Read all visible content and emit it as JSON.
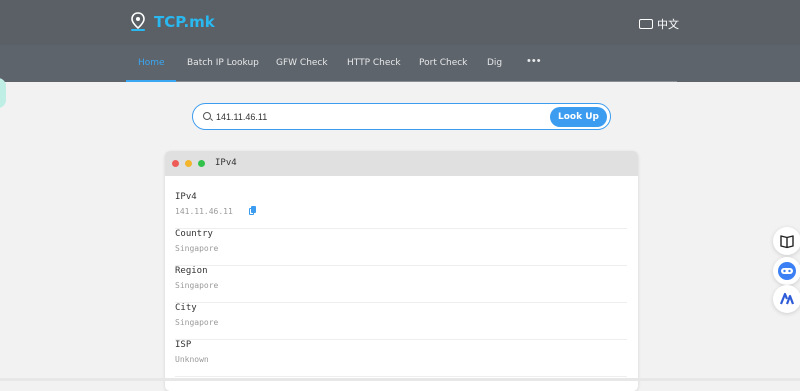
{
  "header": {
    "logo_text": "TCP.mk",
    "language_label": "中文"
  },
  "nav": {
    "items": [
      {
        "label": "Home",
        "active": true
      },
      {
        "label": "Batch IP Lookup",
        "active": false
      },
      {
        "label": "GFW Check",
        "active": false
      },
      {
        "label": "HTTP Check",
        "active": false
      },
      {
        "label": "Port Check",
        "active": false
      },
      {
        "label": "Dig",
        "active": false
      }
    ],
    "more_label": "•••"
  },
  "search": {
    "value": "141.11.46.11",
    "placeholder": "",
    "button_label": "Look Up"
  },
  "card": {
    "title": "IPv4",
    "rows": [
      {
        "label": "IPv4",
        "value": "141.11.46.11"
      },
      {
        "label": "Country",
        "value": "Singapore"
      },
      {
        "label": "Region",
        "value": "Singapore"
      },
      {
        "label": "City",
        "value": "Singapore"
      },
      {
        "label": "ISP",
        "value": "Unknown"
      }
    ]
  },
  "colors": {
    "accent": "#3b9cf0",
    "logo": "#29b8f0",
    "header_bg": "#5b6067",
    "dot_red": "#ee5b57",
    "dot_yellow": "#f2b52c",
    "dot_green": "#32c14a"
  },
  "floating_buttons": [
    "book-icon",
    "robot-icon",
    "ai-logo-icon"
  ]
}
